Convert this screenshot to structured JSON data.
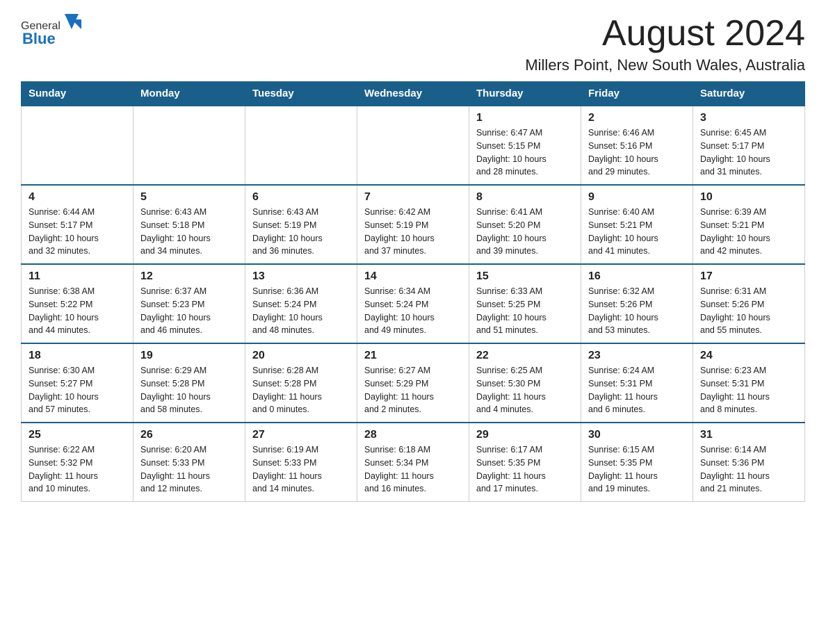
{
  "header": {
    "logo_general": "General",
    "logo_blue": "Blue",
    "month_title": "August 2024",
    "location": "Millers Point, New South Wales, Australia"
  },
  "calendar": {
    "days_of_week": [
      "Sunday",
      "Monday",
      "Tuesday",
      "Wednesday",
      "Thursday",
      "Friday",
      "Saturday"
    ],
    "weeks": [
      [
        {
          "day": "",
          "info": ""
        },
        {
          "day": "",
          "info": ""
        },
        {
          "day": "",
          "info": ""
        },
        {
          "day": "",
          "info": ""
        },
        {
          "day": "1",
          "info": "Sunrise: 6:47 AM\nSunset: 5:15 PM\nDaylight: 10 hours\nand 28 minutes."
        },
        {
          "day": "2",
          "info": "Sunrise: 6:46 AM\nSunset: 5:16 PM\nDaylight: 10 hours\nand 29 minutes."
        },
        {
          "day": "3",
          "info": "Sunrise: 6:45 AM\nSunset: 5:17 PM\nDaylight: 10 hours\nand 31 minutes."
        }
      ],
      [
        {
          "day": "4",
          "info": "Sunrise: 6:44 AM\nSunset: 5:17 PM\nDaylight: 10 hours\nand 32 minutes."
        },
        {
          "day": "5",
          "info": "Sunrise: 6:43 AM\nSunset: 5:18 PM\nDaylight: 10 hours\nand 34 minutes."
        },
        {
          "day": "6",
          "info": "Sunrise: 6:43 AM\nSunset: 5:19 PM\nDaylight: 10 hours\nand 36 minutes."
        },
        {
          "day": "7",
          "info": "Sunrise: 6:42 AM\nSunset: 5:19 PM\nDaylight: 10 hours\nand 37 minutes."
        },
        {
          "day": "8",
          "info": "Sunrise: 6:41 AM\nSunset: 5:20 PM\nDaylight: 10 hours\nand 39 minutes."
        },
        {
          "day": "9",
          "info": "Sunrise: 6:40 AM\nSunset: 5:21 PM\nDaylight: 10 hours\nand 41 minutes."
        },
        {
          "day": "10",
          "info": "Sunrise: 6:39 AM\nSunset: 5:21 PM\nDaylight: 10 hours\nand 42 minutes."
        }
      ],
      [
        {
          "day": "11",
          "info": "Sunrise: 6:38 AM\nSunset: 5:22 PM\nDaylight: 10 hours\nand 44 minutes."
        },
        {
          "day": "12",
          "info": "Sunrise: 6:37 AM\nSunset: 5:23 PM\nDaylight: 10 hours\nand 46 minutes."
        },
        {
          "day": "13",
          "info": "Sunrise: 6:36 AM\nSunset: 5:24 PM\nDaylight: 10 hours\nand 48 minutes."
        },
        {
          "day": "14",
          "info": "Sunrise: 6:34 AM\nSunset: 5:24 PM\nDaylight: 10 hours\nand 49 minutes."
        },
        {
          "day": "15",
          "info": "Sunrise: 6:33 AM\nSunset: 5:25 PM\nDaylight: 10 hours\nand 51 minutes."
        },
        {
          "day": "16",
          "info": "Sunrise: 6:32 AM\nSunset: 5:26 PM\nDaylight: 10 hours\nand 53 minutes."
        },
        {
          "day": "17",
          "info": "Sunrise: 6:31 AM\nSunset: 5:26 PM\nDaylight: 10 hours\nand 55 minutes."
        }
      ],
      [
        {
          "day": "18",
          "info": "Sunrise: 6:30 AM\nSunset: 5:27 PM\nDaylight: 10 hours\nand 57 minutes."
        },
        {
          "day": "19",
          "info": "Sunrise: 6:29 AM\nSunset: 5:28 PM\nDaylight: 10 hours\nand 58 minutes."
        },
        {
          "day": "20",
          "info": "Sunrise: 6:28 AM\nSunset: 5:28 PM\nDaylight: 11 hours\nand 0 minutes."
        },
        {
          "day": "21",
          "info": "Sunrise: 6:27 AM\nSunset: 5:29 PM\nDaylight: 11 hours\nand 2 minutes."
        },
        {
          "day": "22",
          "info": "Sunrise: 6:25 AM\nSunset: 5:30 PM\nDaylight: 11 hours\nand 4 minutes."
        },
        {
          "day": "23",
          "info": "Sunrise: 6:24 AM\nSunset: 5:31 PM\nDaylight: 11 hours\nand 6 minutes."
        },
        {
          "day": "24",
          "info": "Sunrise: 6:23 AM\nSunset: 5:31 PM\nDaylight: 11 hours\nand 8 minutes."
        }
      ],
      [
        {
          "day": "25",
          "info": "Sunrise: 6:22 AM\nSunset: 5:32 PM\nDaylight: 11 hours\nand 10 minutes."
        },
        {
          "day": "26",
          "info": "Sunrise: 6:20 AM\nSunset: 5:33 PM\nDaylight: 11 hours\nand 12 minutes."
        },
        {
          "day": "27",
          "info": "Sunrise: 6:19 AM\nSunset: 5:33 PM\nDaylight: 11 hours\nand 14 minutes."
        },
        {
          "day": "28",
          "info": "Sunrise: 6:18 AM\nSunset: 5:34 PM\nDaylight: 11 hours\nand 16 minutes."
        },
        {
          "day": "29",
          "info": "Sunrise: 6:17 AM\nSunset: 5:35 PM\nDaylight: 11 hours\nand 17 minutes."
        },
        {
          "day": "30",
          "info": "Sunrise: 6:15 AM\nSunset: 5:35 PM\nDaylight: 11 hours\nand 19 minutes."
        },
        {
          "day": "31",
          "info": "Sunrise: 6:14 AM\nSunset: 5:36 PM\nDaylight: 11 hours\nand 21 minutes."
        }
      ]
    ]
  }
}
